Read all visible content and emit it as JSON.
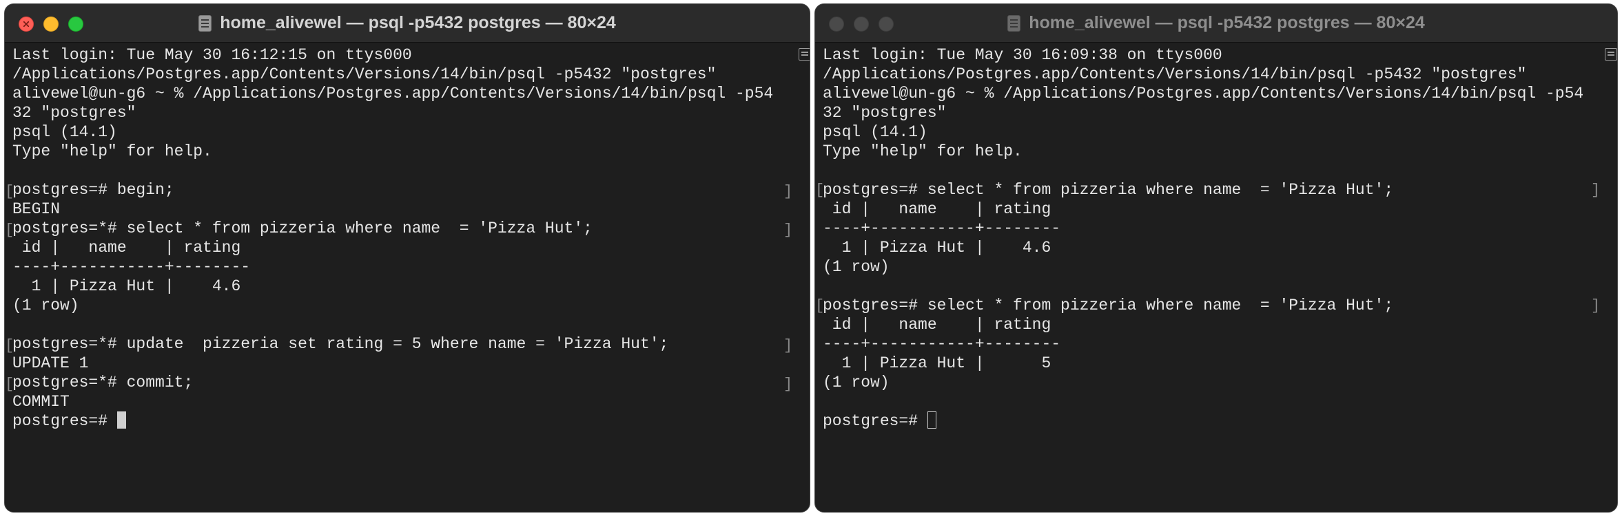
{
  "left_window": {
    "title": "home_alivewel — psql -p5432 postgres — 80×24",
    "prompt": "postgres=# ",
    "lines": [
      "Last login: Tue May 30 16:12:15 on ttys000",
      "/Applications/Postgres.app/Contents/Versions/14/bin/psql -p5432 \"postgres\"",
      "alivewel@un-g6 ~ % /Applications/Postgres.app/Contents/Versions/14/bin/psql -p54",
      "32 \"postgres\"",
      "psql (14.1)",
      "Type \"help\" for help.",
      "",
      "postgres=# begin;",
      "BEGIN",
      "postgres=*# select * from pizzeria where name  = 'Pizza Hut';",
      " id |   name    | rating",
      "----+-----------+--------",
      "  1 | Pizza Hut |    4.6",
      "(1 row)",
      "",
      "postgres=*# update  pizzeria set rating = 5 where name = 'Pizza Hut';",
      "UPDATE 1",
      "postgres=*# commit;",
      "COMMIT"
    ]
  },
  "right_window": {
    "title": "home_alivewel — psql -p5432 postgres — 80×24",
    "prompt": "postgres=# ",
    "lines": [
      "Last login: Tue May 30 16:09:38 on ttys000",
      "/Applications/Postgres.app/Contents/Versions/14/bin/psql -p5432 \"postgres\"",
      "alivewel@un-g6 ~ % /Applications/Postgres.app/Contents/Versions/14/bin/psql -p54",
      "32 \"postgres\"",
      "psql (14.1)",
      "Type \"help\" for help.",
      "",
      "postgres=# select * from pizzeria where name  = 'Pizza Hut';",
      " id |   name    | rating",
      "----+-----------+--------",
      "  1 | Pizza Hut |    4.6",
      "(1 row)",
      "",
      "postgres=# select * from pizzeria where name  = 'Pizza Hut';",
      " id |   name    | rating",
      "----+-----------+--------",
      "  1 | Pizza Hut |      5",
      "(1 row)",
      ""
    ]
  }
}
